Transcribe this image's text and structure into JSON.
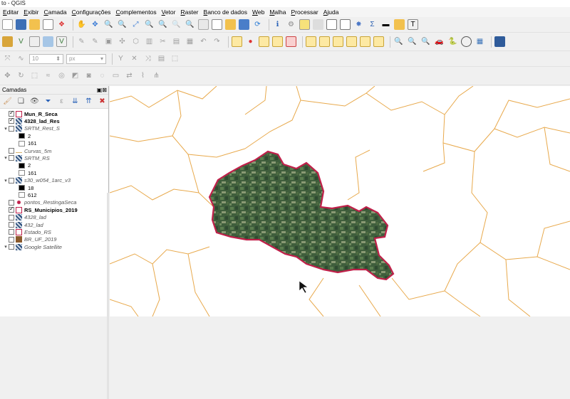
{
  "window": {
    "title": "to - QGIS"
  },
  "menu": [
    "Editar",
    "Exibir",
    "Camada",
    "Configurações",
    "Complementos",
    "Vetor",
    "Raster",
    "Banco de dados",
    "Web",
    "Malha",
    "Processar",
    "Ajuda"
  ],
  "digitizing": {
    "size_value": "10",
    "unit_value": "px"
  },
  "layers_panel": {
    "title": "Camadas",
    "layers": [
      {
        "name": "Mun_R_Seca",
        "checked": true,
        "bold": true,
        "italic": false,
        "icon": "polygon-layer-icon",
        "expand": ""
      },
      {
        "name": "4328_lad_Res",
        "checked": true,
        "bold": true,
        "italic": false,
        "icon": "raster-layer-icon",
        "expand": ""
      },
      {
        "name": "SRTM_Rest_S",
        "checked": false,
        "bold": false,
        "italic": true,
        "icon": "raster-layer-icon",
        "expand": "▾"
      },
      {
        "legend": "2",
        "color": "#000000"
      },
      {
        "legend": "161",
        "color": "#ffffff"
      },
      {
        "name": "Curvas_5m",
        "checked": false,
        "bold": false,
        "italic": true,
        "icon": "line-layer-icon",
        "expand": ""
      },
      {
        "name": "SRTM_RS",
        "checked": false,
        "bold": false,
        "italic": true,
        "icon": "raster-layer-icon",
        "expand": "▾"
      },
      {
        "legend": "2",
        "color": "#000000"
      },
      {
        "legend": "161",
        "color": "#ffffff"
      },
      {
        "name": "s30_w054_1arc_v3",
        "checked": false,
        "bold": false,
        "italic": true,
        "icon": "raster-layer-icon",
        "expand": "▾"
      },
      {
        "legend": "18",
        "color": "#000000"
      },
      {
        "legend": "612",
        "color": "#ffffff"
      },
      {
        "name": "pontos_RestingaSeca",
        "checked": false,
        "bold": false,
        "italic": true,
        "icon": "point-layer-icon",
        "expand": ""
      },
      {
        "name": "RS_Municipios_2019",
        "checked": true,
        "bold": true,
        "italic": false,
        "icon": "polygon-layer-icon",
        "expand": ""
      },
      {
        "name": "4328_lad",
        "checked": false,
        "bold": false,
        "italic": true,
        "icon": "raster-layer-icon",
        "expand": ""
      },
      {
        "name": "432_lad",
        "checked": false,
        "bold": false,
        "italic": true,
        "icon": "raster-layer-icon",
        "expand": ""
      },
      {
        "name": "Estado_RS",
        "checked": false,
        "bold": false,
        "italic": true,
        "icon": "polygon-layer-icon",
        "expand": ""
      },
      {
        "name": "BR_UF_2019",
        "checked": false,
        "bold": false,
        "italic": true,
        "icon": "fill-layer-icon",
        "expand": ""
      },
      {
        "name": "Google Satellite",
        "checked": false,
        "bold": false,
        "italic": true,
        "icon": "raster-layer-icon",
        "expand": "▾"
      }
    ]
  },
  "colors": {
    "boundary": "#e8a94c",
    "selected_outline": "#c0204a",
    "satellite": "#3c5a3a"
  }
}
